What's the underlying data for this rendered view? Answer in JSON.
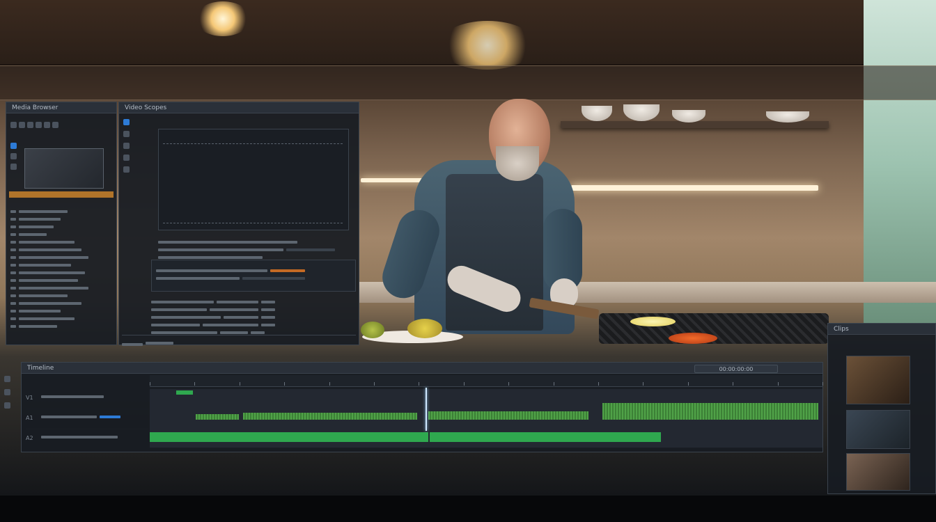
{
  "app": {
    "source_panel_title": "Media Browser",
    "scope_panel_title": "Video Scopes",
    "timeline_title": "Timeline",
    "right_panel_title": "Clips"
  },
  "timeline": {
    "timecode": "00:00:00:00",
    "tracks": [
      {
        "label": "V1"
      },
      {
        "label": "A1"
      },
      {
        "label": "A2"
      }
    ],
    "playhead_fraction": 0.41
  },
  "colors": {
    "panel": "#181c22",
    "accent": "#2d7bd6",
    "waveform": "#55b04a",
    "clip": "#2fa84f"
  },
  "icons": [
    "play-icon",
    "folder-icon",
    "scissors-icon",
    "zoom-icon",
    "gear-icon",
    "audio-icon"
  ]
}
